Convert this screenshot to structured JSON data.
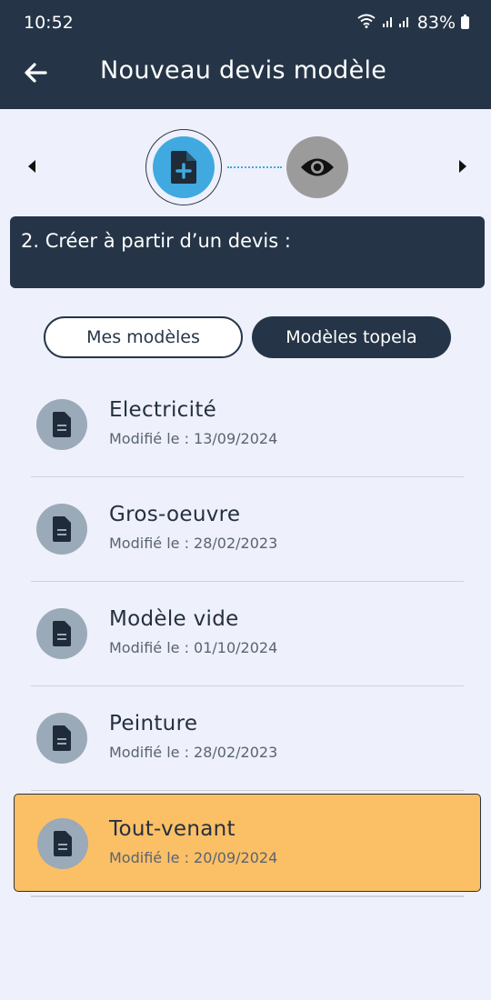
{
  "status_bar": {
    "time": "10:52",
    "battery": "83%"
  },
  "header": {
    "title": "Nouveau devis modèle"
  },
  "banner": {
    "text": "2. Créer à partir d’un devis :"
  },
  "tabs": [
    {
      "label": "Mes modèles",
      "active": false
    },
    {
      "label": "Modèles topela",
      "active": true
    }
  ],
  "models": [
    {
      "name": "Electricité",
      "modified": "Modifié le : 13/09/2024"
    },
    {
      "name": "Gros-oeuvre",
      "modified": "Modifié le : 28/02/2023"
    },
    {
      "name": "Modèle vide",
      "modified": "Modifié le : 01/10/2024"
    },
    {
      "name": "Peinture",
      "modified": "Modifié le : 28/02/2023"
    },
    {
      "name": "Tout-venant",
      "modified": "Modifié le : 20/09/2024",
      "selected": true
    }
  ],
  "colors": {
    "header_bg": "#253547",
    "page_bg": "#eef0fb",
    "step_active": "#40a9df",
    "step_inactive": "#9b9b9b",
    "selected_item": "#fbbf66",
    "avatar_bg": "#9aaab8"
  },
  "icons": [
    "back-arrow-icon",
    "wifi-icon",
    "signal-icon",
    "battery-icon",
    "chevron-left-icon",
    "chevron-right-icon",
    "file-add-icon",
    "eye-icon",
    "document-icon"
  ]
}
